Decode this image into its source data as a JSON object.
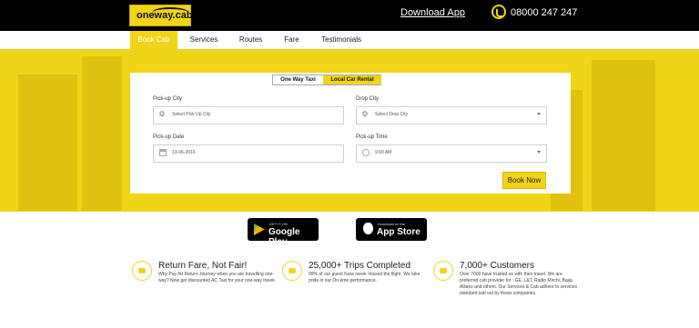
{
  "header": {
    "logo_text": "oneway.cab",
    "download_app": "Download App",
    "phone": "08000 247 247"
  },
  "nav": {
    "items": [
      "Book Cab",
      "Services",
      "Routes",
      "Fare",
      "Testimonials"
    ],
    "active": "Book Cab"
  },
  "booking": {
    "tabs": [
      "One Way Taxi",
      "Local Car Rental"
    ],
    "active_tab": "Local Car Rental",
    "pickup_city": {
      "label": "Pick-up City",
      "value": "Select Pick Up City"
    },
    "drop_city": {
      "label": "Drop City",
      "value": "Select Drop City"
    },
    "pickup_date": {
      "label": "Pick-up Date",
      "value": "13-06-2016"
    },
    "pickup_time": {
      "label": "Pick-up Time",
      "value": "9:00 AM"
    },
    "book_button": "Book Now"
  },
  "stores": {
    "google": {
      "small": "GET IT ON",
      "big": "Google Play"
    },
    "apple": {
      "small": "Download on the",
      "big": "App Store"
    }
  },
  "features": [
    {
      "title": "Return Fare, Not Fair!",
      "text": "Why Pay for Return Journey when you are travelling one-way? Now get discounted AC Taxi for your one-way travel."
    },
    {
      "title": "25,000+ Trips Completed",
      "text": "99% of our guest have never missed the flight. We take pride in our On-time performance."
    },
    {
      "title": "7,000+ Customers",
      "text": "Over 7000 have trusted us with their travel. We are preferred cab provider for : GE, L&T, Radio Mirchi, Bajaj Allianz and others. Our Services & Cab adhere to services standard laid out by these companies."
    }
  ],
  "colors": {
    "accent": "#f1d318",
    "header_bg": "#000000"
  }
}
